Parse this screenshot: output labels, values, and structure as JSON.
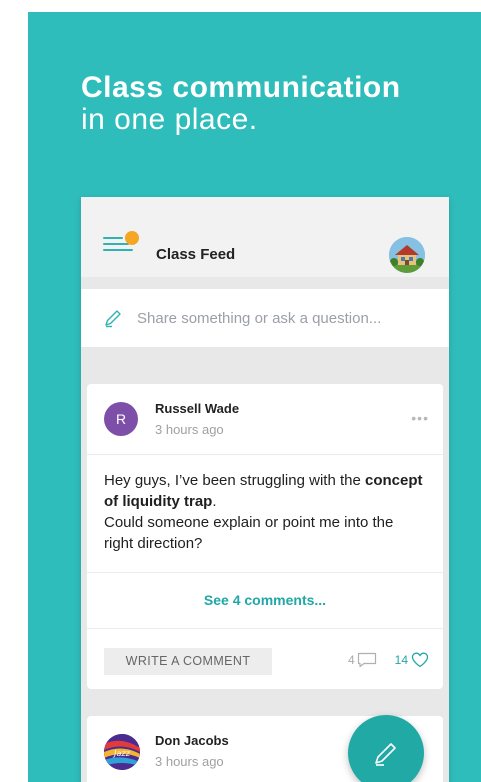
{
  "headline": {
    "line1": "Class communication",
    "line2": "in one place."
  },
  "appbar": {
    "title": "Class Feed"
  },
  "composer": {
    "placeholder": "Share something or ask a question..."
  },
  "posts": [
    {
      "avatar_initial": "R",
      "author": "Russell Wade",
      "time": "3 hours ago",
      "more": "•••",
      "body_before": "Hey guys, I’ve been struggling with the ",
      "body_bold": "concept of liquidity trap",
      "body_after": ".\nCould someone explain or point me into the right direction?",
      "see_comments": "See 4 comments...",
      "write_comment": "WRITE A COMMENT",
      "comment_count": "4",
      "like_count": "14"
    },
    {
      "author": "Don Jacobs",
      "time": "3 hours ago"
    }
  ],
  "colors": {
    "teal_bg": "#2fbdbb",
    "accent": "#20a8a6",
    "orange_dot": "#f5a623",
    "avatar_purple": "#7e4fa8"
  }
}
